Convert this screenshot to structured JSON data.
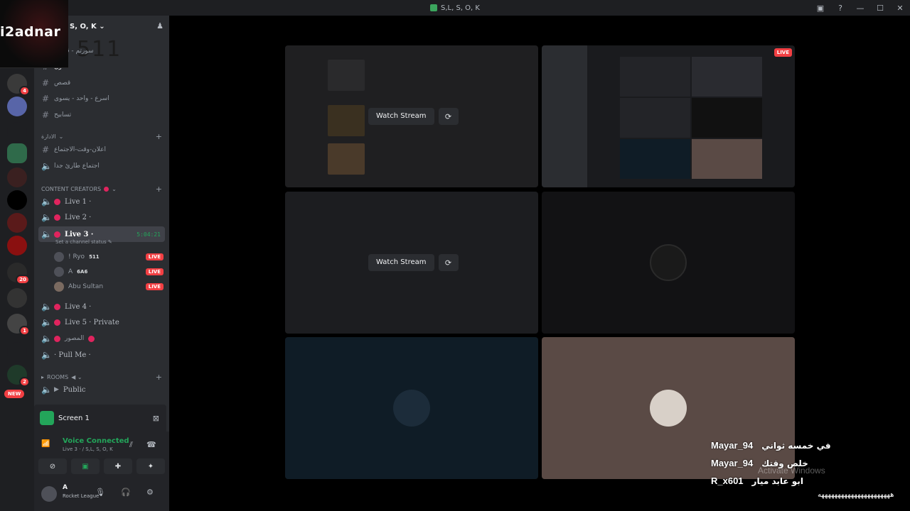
{
  "window": {
    "title": "S,L, S, O, K",
    "controls": [
      "▣",
      "?",
      "—",
      "☐",
      "✕"
    ]
  },
  "overlay": {
    "brand": "i2adnar",
    "number": "511"
  },
  "server": {
    "name": "S, O, K",
    "rail_badges": [
      "4",
      "20",
      "1",
      "2"
    ],
    "new_label": "NEW"
  },
  "channels": [
    {
      "label": "سورتم - قديمه"
    },
    {
      "label": "فنون"
    },
    {
      "label": "قصص"
    },
    {
      "label": "اسرع - واحد - يسوى"
    },
    {
      "label": "تسابيح"
    }
  ],
  "categories": {
    "admin": "الادارة",
    "admin_channels": [
      "اعلان-وقت-الاجتماع",
      "اجتماع طارئ جدا"
    ],
    "content": "CONTENT CREATORS",
    "rooms": "ROOMS"
  },
  "voice_channels": [
    {
      "label": "Live 1 ·"
    },
    {
      "label": "Live 2 ·"
    },
    {
      "label": "Live 3 ·",
      "timer": "5:04:21"
    },
    {
      "label": "Live 4 ·"
    },
    {
      "label": "Live 5 · Private"
    },
    {
      "label": "المصور"
    },
    {
      "label": "· Pull Me ·"
    },
    {
      "label": "Public"
    }
  ],
  "channel_status": "Set a channel status",
  "members": [
    {
      "name": "! Ryo",
      "tag": "511",
      "live": "LIVE"
    },
    {
      "name": "A",
      "tag": "6A6",
      "live": "LIVE"
    },
    {
      "name": "Abu Sultan",
      "tag": "",
      "live": "LIVE"
    }
  ],
  "screen_panel": {
    "label": "Screen 1"
  },
  "voice": {
    "status": "Voice Connected",
    "detail": "Live 3 · / S,L, S, O, K"
  },
  "user": {
    "name": "A",
    "activity": "Rocket League"
  },
  "streams": {
    "watch_label": "Watch Stream",
    "live_badge": "LIVE"
  },
  "chat": [
    {
      "nick": "Mayar_94",
      "message": "في خمسه ثواني"
    },
    {
      "nick": "Mayar_94",
      "message": "خلص وقتك"
    },
    {
      "nick": "R_x601",
      "message": "ابو عابد ميار"
    }
  ],
  "chat_tail": "ههههههههههههههههههههههه",
  "watermark": "Activate Windows"
}
